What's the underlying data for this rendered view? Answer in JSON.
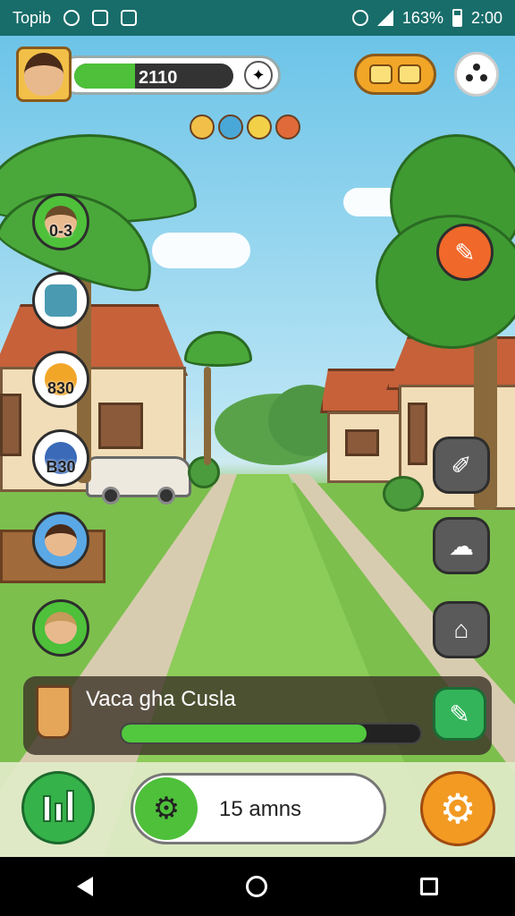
{
  "status_bar": {
    "app_name": "Topib",
    "battery": "163%",
    "time": "2:00",
    "icons": [
      "location-icon",
      "clipboard-icon",
      "alert-icon",
      "wifi-icon",
      "signal-icon",
      "battery-icon"
    ]
  },
  "hud": {
    "xp_value": "2110",
    "xp_fraction": 0.38
  },
  "quests": [
    {
      "name": "quest-villager-1",
      "label": "0-3"
    },
    {
      "name": "quest-robot",
      "label": ""
    },
    {
      "name": "quest-leaf",
      "label": "830"
    },
    {
      "name": "quest-blue-hat",
      "label": "B30"
    },
    {
      "name": "quest-villager-2",
      "label": ""
    },
    {
      "name": "quest-villager-3",
      "label": ""
    }
  ],
  "task": {
    "title": "Vaca gha Cusla",
    "progress": 0.82
  },
  "timer": {
    "text": "15 amns"
  },
  "colors": {
    "status_bar": "#186d6a",
    "accent_green": "#4ec03a",
    "accent_orange": "#f29a22"
  }
}
